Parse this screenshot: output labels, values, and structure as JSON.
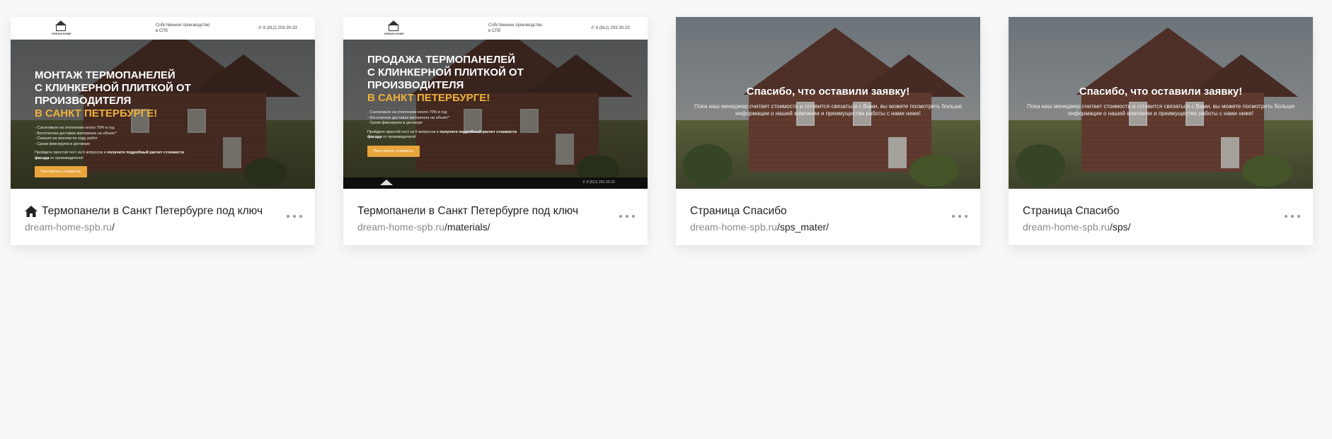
{
  "pages": [
    {
      "is_home": true,
      "title": "Термопанели в Санкт Петербурге под ключ",
      "domain": "dream-home-spb.ru",
      "path": "/",
      "preview": {
        "type": "landing",
        "logo_text": "DREAM HOME",
        "tagline": "Собственное производство в СПб",
        "phone": "8 (812) 203-30-33",
        "title_line1": "МОНТАЖ ТЕРМОПАНЕЛЕЙ",
        "title_line2": "С КЛИНКЕРНОЙ ПЛИТКОЙ ОТ",
        "title_line3": "ПРОИЗВОДИТЕЛЯ",
        "title_accent": "В САНКТ ПЕТЕРБУРГЕ!",
        "bullets": [
          "- Сэкономьте на отоплении около 70% в год",
          "- Бесплатная доставка материала на объект*",
          "- Скиньте на монтаж по ходу работ",
          "- Сроки фиксируем в договоре"
        ],
        "cta_prefix": "Пройдите простой тест из 6 вопросов и",
        "cta_bold": "получите подробный расчет стоимости фасада",
        "cta_suffix": "от производителя!",
        "button": "Рассчитать стоимость"
      }
    },
    {
      "is_home": false,
      "title": "Термопанели в Санкт Петербурге под ключ",
      "domain": "dream-home-spb.ru",
      "path": "/materials/",
      "preview": {
        "type": "landing",
        "logo_text": "DREAM HOME",
        "tagline": "Собственное производство в СПб",
        "phone": "8 (812) 203-30-33",
        "title_line1": "ПРОДАЖА ТЕРМОПАНЕЛЕЙ",
        "title_line2": "С КЛИНКЕРНОЙ ПЛИТКОЙ ОТ",
        "title_line3": "ПРОИЗВОДИТЕЛЯ",
        "title_accent": "В САНКТ ПЕТЕРБУРГЕ!",
        "bullets": [
          "- Сэкономьте на отоплении около 70% в год",
          "- Бесплатная доставка материала на объект*",
          "- Сроки фиксируем в договоре"
        ],
        "cta_prefix": "Пройдите простой тест из 6 вопросов и",
        "cta_bold": "получите подробный расчет стоимости фасада",
        "cta_suffix": "от производителя!",
        "button": "Рассчитать стоимость",
        "footer_phone": "8 (812) 203-30-33"
      }
    },
    {
      "is_home": false,
      "title": "Страница Спасибо",
      "domain": "dream-home-spb.ru",
      "path": "/sps_mater/",
      "preview": {
        "type": "thanks",
        "heading": "Спасибо, что оставили заявку!",
        "text": "Пока наш менеджер считает стоимость и готовится связаться с Вами, вы можете посмотреть больше информации о нашей компании и преимущества работы с нами ниже!"
      }
    },
    {
      "is_home": false,
      "title": "Страница Спасибо",
      "domain": "dream-home-spb.ru",
      "path": "/sps/",
      "preview": {
        "type": "thanks",
        "heading": "Спасибо, что оставили заявку!",
        "text": "Пока наш менеджер считает стоимость и готовится связаться с Вами, вы можете посмотреть больше информации о нашей компании и преимущества работы с нами ниже!"
      }
    }
  ],
  "icons": {
    "home": "home-icon",
    "more": "more-options-icon"
  }
}
